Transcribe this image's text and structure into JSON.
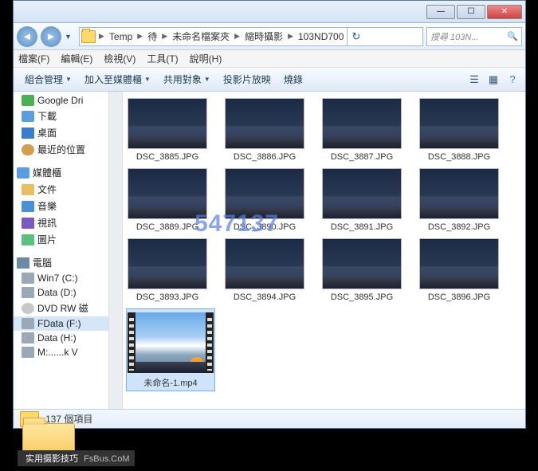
{
  "titlebar": {
    "min": "—",
    "max": "☐",
    "close": "✕"
  },
  "nav": {
    "back": "◄",
    "fwd": "►",
    "dd": "▼"
  },
  "breadcrumb": [
    "Temp",
    "待",
    "未命名檔案夾",
    "縮時攝影",
    "103ND700"
  ],
  "refresh": "↻",
  "search": {
    "placeholder": "搜尋 103N...",
    "mag": "🔍"
  },
  "menu": [
    "檔案(F)",
    "編輯(E)",
    "檢視(V)",
    "工具(T)",
    "說明(H)"
  ],
  "toolbar": {
    "organize": "組合管理",
    "include": "加入至媒體櫃",
    "share": "共用對象",
    "slideshow": "投影片放映",
    "burn": "燒錄",
    "dd": "▼",
    "view": "☰",
    "pane": "▦",
    "help": "?"
  },
  "sidebar": {
    "gdrive": "Google Dri",
    "downloads": "下載",
    "desktop": "桌面",
    "recent": "最近的位置",
    "libraries": "媒體櫃",
    "documents": "文件",
    "music": "音樂",
    "videos": "視訊",
    "pictures": "圖片",
    "computer": "電腦",
    "win7": "Win7 (C:)",
    "dataD": "Data (D:)",
    "dvd": "DVD RW 磁",
    "fdata": "FData (F:)",
    "dataH": "Data (H:)",
    "ms": "M:......k V"
  },
  "files": [
    "DSC_3885.JPG",
    "DSC_3886.JPG",
    "DSC_3887.JPG",
    "DSC_3888.JPG",
    "DSC_3889.JPG",
    "DSC_3890.JPG",
    "DSC_3891.JPG",
    "DSC_3892.JPG",
    "DSC_3893.JPG",
    "DSC_3894.JPG",
    "DSC_3895.JPG",
    "DSC_3896.JPG"
  ],
  "video_file": "未命名-1.mp4",
  "status": "137 個項目",
  "watermark": "547137",
  "footer": {
    "t1": "实用摄影技巧",
    "t2": "FsBus.CoM"
  }
}
